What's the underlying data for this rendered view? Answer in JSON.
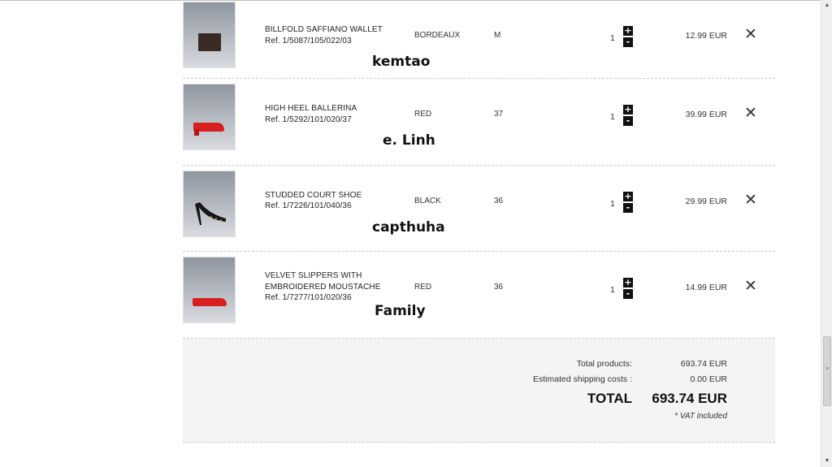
{
  "items": [
    {
      "name_lines": [
        "BILLFOLD SAFFIANO WALLET"
      ],
      "ref": "Ref. 1/5087/105/022/03",
      "color": "BORDEAUX",
      "size": "M",
      "qty": "1",
      "price": "12.99 EUR",
      "watermark": "kemtao"
    },
    {
      "name_lines": [
        "HIGH HEEL BALLERINA"
      ],
      "ref": "Ref. 1/5292/101/020/37",
      "color": "RED",
      "size": "37",
      "qty": "1",
      "price": "39.99 EUR",
      "watermark": "e. Linh"
    },
    {
      "name_lines": [
        "STUDDED COURT SHOE"
      ],
      "ref": "Ref. 1/7226/101/040/36",
      "color": "BLACK",
      "size": "36",
      "qty": "1",
      "price": "29.99 EUR",
      "watermark": "capthuha"
    },
    {
      "name_lines": [
        "VELVET SLIPPERS WITH",
        "EMBROIDERED MOUSTACHE"
      ],
      "ref": "Ref. 1/7277/101/020/36",
      "color": "RED",
      "size": "36",
      "qty": "1",
      "price": "14.99 EUR",
      "watermark": "Family"
    }
  ],
  "controls": {
    "plus": "+",
    "minus": "-",
    "remove": "✕"
  },
  "summary": {
    "total_products_label": "Total products:",
    "total_products_value": "693.74 EUR",
    "shipping_label": "Estimated shipping costs :",
    "shipping_value": "0.00 EUR",
    "total_label": "TOTAL",
    "total_value": "693.74 EUR",
    "vat_note": "* VAT included"
  },
  "scrollbar": {
    "up": "▲",
    "down": "▼",
    "grip": "≡"
  },
  "colors": {
    "product_red": "#d81f1f",
    "wallet": "#3a2a26",
    "shoe_black": "#151515",
    "summary_bg": "#f4f4f4"
  }
}
